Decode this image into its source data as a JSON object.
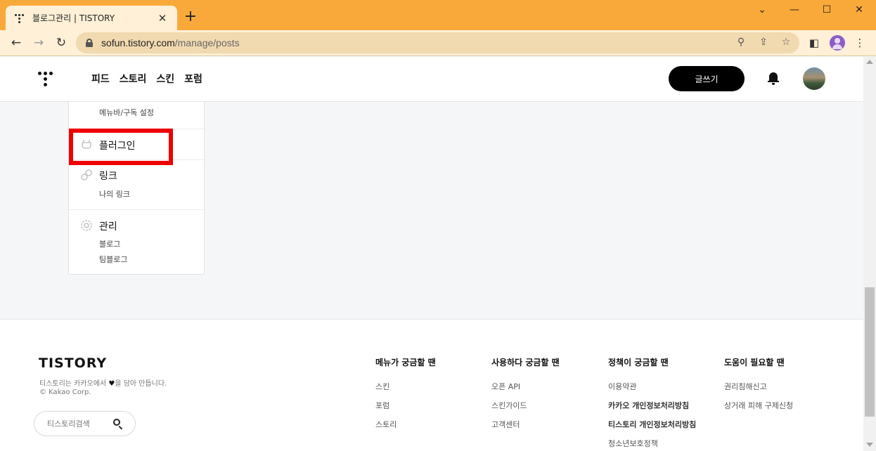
{
  "browser": {
    "tab_title": "블로그관리 | TISTORY",
    "new_tab": "+",
    "url_host": "sofun.tistory.com",
    "url_path": "/manage/posts",
    "controls": {
      "minimize": "⌄",
      "restore": "—",
      "maximize": "☐",
      "close": "✕"
    }
  },
  "header": {
    "nav": [
      "피드",
      "스토리",
      "스킨",
      "포럼"
    ],
    "write_label": "글쓰기"
  },
  "sidebar": {
    "top_sub": "메뉴바/구독 설정",
    "sections": [
      {
        "title": "플러그인",
        "subs": []
      },
      {
        "title": "링크",
        "subs": [
          "나의 링크"
        ]
      },
      {
        "title": "관리",
        "subs": [
          "블로그",
          "팀블로그"
        ]
      }
    ]
  },
  "footer": {
    "brand": "TISTORY",
    "desc_before": "티스토리는 카카오에서 ",
    "desc_after": "을 담아 만듭니다.",
    "copyright": "© Kakao Corp.",
    "search_placeholder": "티스토리검색",
    "columns": [
      {
        "title": "메뉴가 궁금할 땐",
        "links": [
          "스킨",
          "포럼",
          "스토리"
        ]
      },
      {
        "title": "사용하다 궁금할 땐",
        "links": [
          "오픈 API",
          "스킨가이드",
          "고객센터"
        ]
      },
      {
        "title": "정책이 궁금할 땐",
        "links": [
          "이용약관",
          "카카오 개인정보처리방침",
          "티스토리 개인정보처리방침",
          "청소년보호정책"
        ]
      },
      {
        "title": "도움이 필요할 땐",
        "links": [
          "권리침해신고",
          "상거래 피해 구제신청"
        ]
      }
    ]
  },
  "highlight_color": "#ef0000"
}
